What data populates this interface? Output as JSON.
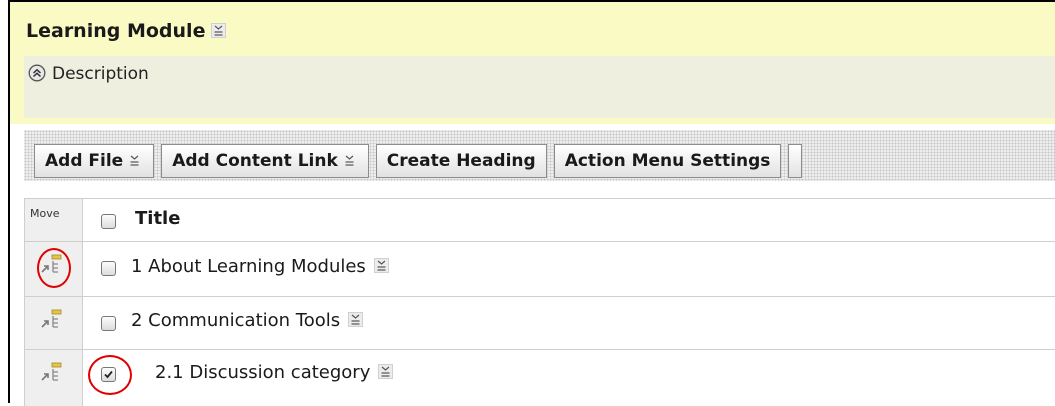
{
  "module": {
    "title": "Learning Module",
    "description_label": "Description"
  },
  "toolbar": {
    "add_file": "Add File",
    "add_content_link": "Add Content Link",
    "create_heading": "Create Heading",
    "action_menu_settings": "Action Menu Settings"
  },
  "table": {
    "header": {
      "move": "Move",
      "title": "Title"
    },
    "rows": [
      {
        "label": "1 About Learning Modules",
        "checked": false,
        "highlighted": true
      },
      {
        "label": "2 Communication Tools",
        "checked": false,
        "highlighted": false
      },
      {
        "label": "2.1 Discussion category",
        "checked": true,
        "highlighted": true
      }
    ]
  },
  "colors": {
    "header_bg": "#fafac4",
    "annotation_red": "#e00000"
  },
  "icons": {
    "menu": "context-menu-icon",
    "collapse": "collapse-up-icon",
    "move": "move-drag-icon"
  }
}
